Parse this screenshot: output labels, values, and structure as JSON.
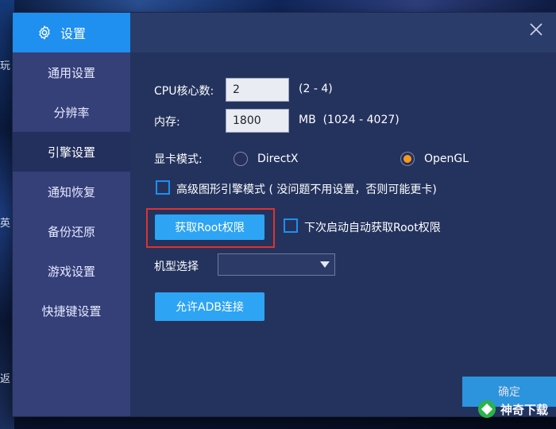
{
  "background": {
    "left_glyphs": [
      "玩",
      "英",
      "返"
    ]
  },
  "sidebar": {
    "title": "设置",
    "items": [
      {
        "label": "通用设置"
      },
      {
        "label": "分辨率"
      },
      {
        "label": "引擎设置",
        "active": true
      },
      {
        "label": "通知恢复"
      },
      {
        "label": "备份还原"
      },
      {
        "label": "游戏设置"
      },
      {
        "label": "快捷键设置"
      }
    ]
  },
  "engine": {
    "cpu_label": "CPU核心数:",
    "cpu_value": "2",
    "cpu_range": "(2 - 4)",
    "memory_label": "内存:",
    "memory_value": "1800",
    "memory_range": "MB  (1024 - 4027)",
    "gpu_label": "显卡模式:",
    "gpu_options": [
      {
        "label": "DirectX",
        "selected": false
      },
      {
        "label": "OpenGL",
        "selected": true
      }
    ],
    "advanced_label": "高级图形引擎模式 ( 没问题不用设置，否则可能更卡)",
    "root_button": "获取Root权限",
    "auto_root_label": "下次启动自动获取Root权限",
    "model_label": "机型选择",
    "model_value": "",
    "adb_button": "允许ADB连接"
  },
  "confirm_button": "确定",
  "watermark": "神奇下载",
  "colors": {
    "accent": "#1f8ff0",
    "button": "#2ea4f4",
    "highlight": "#e0322e",
    "radio_selected": "#f59a1c"
  }
}
